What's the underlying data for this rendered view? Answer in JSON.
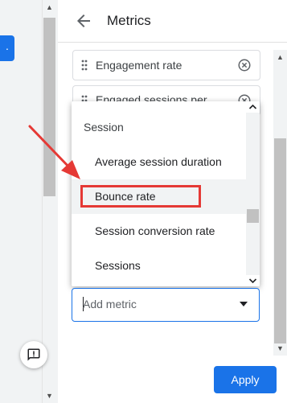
{
  "left": {
    "tab_glyph": "."
  },
  "header": {
    "title": "Metrics"
  },
  "metrics": [
    {
      "label": "Engagement rate"
    },
    {
      "label": "Engaged sessions per"
    }
  ],
  "dropdown": {
    "group": "Session",
    "options": [
      {
        "label": "Average session duration"
      },
      {
        "label": "Bounce rate"
      },
      {
        "label": "Session conversion rate"
      },
      {
        "label": "Sessions"
      }
    ],
    "highlighted": "Bounce rate"
  },
  "add_metric": {
    "placeholder": "Add metric"
  },
  "footer": {
    "apply_label": "Apply"
  },
  "colors": {
    "accent": "#1a73e8",
    "annotation": "#e53935"
  }
}
